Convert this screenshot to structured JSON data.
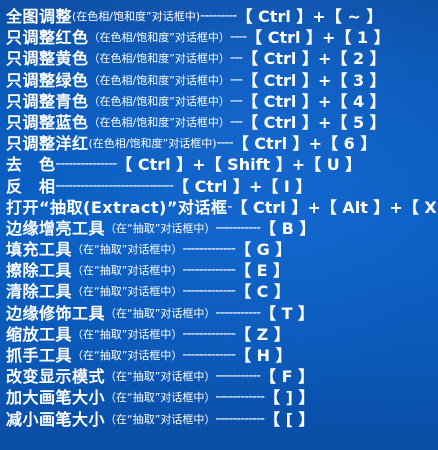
{
  "rows": [
    {
      "tool": "全图调整",
      "note": "(在色相/饱和度”对话框中)",
      "dash": "---------",
      "key": "【 Ctrl 】+【 ~ 】"
    },
    {
      "tool": "只调整红色",
      "note": "（在色相/饱和度”对话框中）",
      "dash": "----",
      "key": "【 Ctrl 】+【 1 】"
    },
    {
      "tool": "只调整黄色",
      "note": "（在色相/饱和度”对话框中）",
      "dash": "---",
      "key": "【 Ctrl 】+【 2 】"
    },
    {
      "tool": "只调整绿色",
      "note": "（在色相/饱和度”对话框中）",
      "dash": "---",
      "key": "【 Ctrl 】+【 3 】"
    },
    {
      "tool": "只调整青色",
      "note": "（在色相/饱和度”对话框中）",
      "dash": "---",
      "key": "【 Ctrl 】+【 4 】"
    },
    {
      "tool": "只调整蓝色",
      "note": "（在色相/饱和度”对话框中）",
      "dash": "---",
      "key": "【 Ctrl 】+【 5 】"
    },
    {
      "tool": "只调整洋红",
      "note": "(在色相/饱和度”对话框中)",
      "dash": "----",
      "key": "【 Ctrl 】+【 6 】"
    },
    {
      "tool": "去　色",
      "note": "",
      "dash": "---------------",
      "key": "【 Ctrl 】+【 Shift 】+【 U 】"
    },
    {
      "tool": "反　相",
      "note": "",
      "dash": "-----------------------------",
      "key": "【 Ctrl 】+【 I 】"
    },
    {
      "tool": "打开“抽取(Extract)”对话框",
      "note": "",
      "dash": "-",
      "key": "【 Ctrl 】+【 Alt 】+【 X 】"
    },
    {
      "tool": "边缘增亮工具",
      "note": "（在“抽取”对话框中）",
      "dash": "-----------",
      "key": "【 B 】"
    },
    {
      "tool": "填充工具",
      "note": "（在“抽取”对话框中）",
      "dash": "-------------",
      "key": "【 G 】"
    },
    {
      "tool": "擦除工具",
      "note": "（在“抽取”对话框中）",
      "dash": "-------------",
      "key": "【 E 】"
    },
    {
      "tool": "清除工具",
      "note": "（在“抽取”对话框中）",
      "dash": "-------------",
      "key": "【 C 】"
    },
    {
      "tool": "边缘修饰工具",
      "note": "（在“抽取”对话框中）",
      "dash": "-----------",
      "key": "【 T 】"
    },
    {
      "tool": "缩放工具",
      "note": "（在“抽取”对话框中）",
      "dash": "-------------",
      "key": "【 Z 】"
    },
    {
      "tool": "抓手工具",
      "note": "（在“抽取”对话框中）",
      "dash": "-------------",
      "key": "【 H 】"
    },
    {
      "tool": "改变显示模式",
      "note": "（在“抽取”对话框中）",
      "dash": "-----------",
      "key": "【 F 】"
    },
    {
      "tool": "加大画笔大小",
      "note": "（在“抽取”对话框中）",
      "dash": "------------",
      "key": "【 ] 】"
    },
    {
      "tool": "减小画笔大小",
      "note": "（在“抽取”对话框中）",
      "dash": "------------",
      "key": "【 [ 】"
    }
  ]
}
